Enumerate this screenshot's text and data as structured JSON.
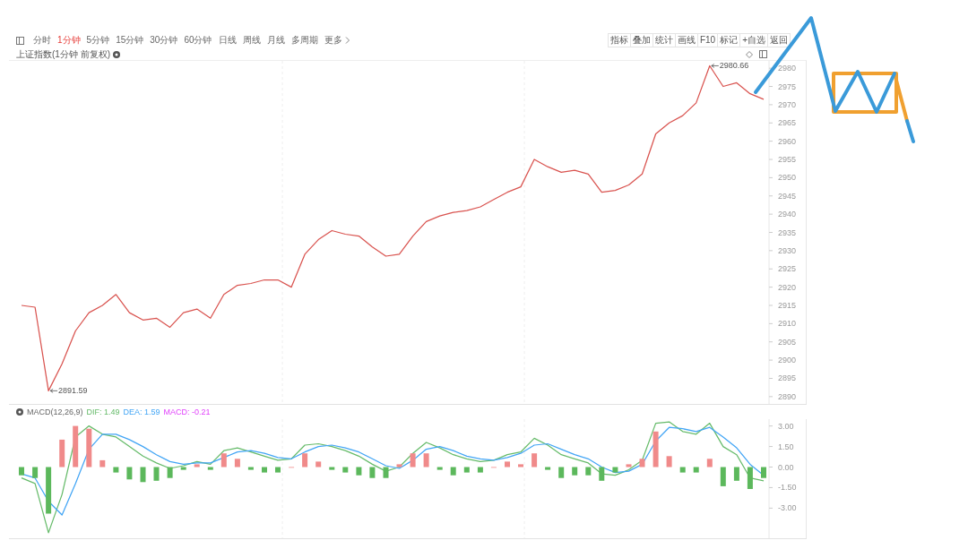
{
  "toolbar": {
    "periods": [
      {
        "label": "分时",
        "selected": false
      },
      {
        "label": "1分钟",
        "selected": true
      },
      {
        "label": "5分钟",
        "selected": false
      },
      {
        "label": "15分钟",
        "selected": false
      },
      {
        "label": "30分钟",
        "selected": false
      },
      {
        "label": "60分钟",
        "selected": false
      },
      {
        "label": "日线",
        "selected": false
      },
      {
        "label": "周线",
        "selected": false
      },
      {
        "label": "月线",
        "selected": false
      },
      {
        "label": "多周期",
        "selected": false
      }
    ],
    "more": "更多",
    "tools": [
      "指标",
      "叠加",
      "统计",
      "画线",
      "F10",
      "标记",
      "+自选",
      "返回"
    ]
  },
  "price_panel": {
    "chart_data": {
      "type": "line",
      "title": "上证指数(1分钟 前复权)",
      "categories": [
        null,
        null,
        null,
        null,
        null,
        null,
        null,
        null,
        null,
        null,
        null,
        null,
        null,
        null,
        null,
        null,
        null,
        null,
        null,
        null,
        null,
        null,
        null,
        null,
        null,
        null,
        null,
        null,
        null,
        null,
        null,
        null,
        null,
        null,
        null,
        null,
        null,
        null,
        null,
        null,
        null,
        null,
        null,
        null,
        null,
        null,
        null,
        null,
        null,
        null,
        null,
        null,
        null,
        null,
        null,
        null
      ],
      "series": [
        {
          "color": "#d9534f",
          "values": [
            2915,
            2914.5,
            2891.59,
            2899,
            2908,
            2913,
            2915,
            2918,
            2913,
            2911,
            2911.5,
            2909,
            2913,
            2914,
            2911.5,
            2918,
            2920.5,
            2921,
            2922,
            2922,
            2920,
            2929,
            2933,
            2935.5,
            2934.5,
            2934,
            2931,
            2928.5,
            2929,
            2934,
            2938,
            2939.5,
            2940.5,
            2941,
            2942,
            2944,
            2946,
            2947.5,
            2955,
            2953,
            2951.5,
            2952,
            2951,
            2946,
            2946.5,
            2948,
            2951,
            2962,
            2965,
            2967,
            2970.5,
            2980.66,
            2975,
            2976,
            2973,
            2971.5
          ]
        }
      ],
      "ylim": [
        2888,
        2982
      ],
      "yticks": [
        {
          "value": 2980,
          "label": "2980"
        },
        {
          "value": 2975,
          "label": "2975"
        },
        {
          "value": 2970,
          "label": "2970"
        },
        {
          "value": 2965,
          "label": "2965"
        },
        {
          "value": 2960,
          "label": "2960"
        },
        {
          "value": 2955,
          "label": "2955"
        },
        {
          "value": 2950,
          "label": "2950"
        },
        {
          "value": 2945,
          "label": "2945"
        },
        {
          "value": 2940,
          "label": "2940"
        },
        {
          "value": 2935,
          "label": "2935"
        },
        {
          "value": 2930,
          "label": "2930"
        },
        {
          "value": 2925,
          "label": "2925"
        },
        {
          "value": 2920,
          "label": "2920"
        },
        {
          "value": 2915,
          "label": "2915"
        },
        {
          "value": 2910,
          "label": "2910"
        },
        {
          "value": 2905,
          "label": "2905"
        },
        {
          "value": 2900,
          "label": "2900"
        },
        {
          "value": 2895,
          "label": "2895"
        },
        {
          "value": 2890,
          "label": "2890"
        }
      ],
      "annotations": [
        "2980.66",
        "2891.59"
      ]
    }
  },
  "macd_panel": {
    "chart_data": {
      "type": "bar",
      "title": "MACD(12,26,9)",
      "categories": [
        null,
        null,
        null,
        null,
        null,
        null,
        null,
        null,
        null,
        null,
        null,
        null,
        null,
        null,
        null,
        null,
        null,
        null,
        null,
        null,
        null,
        null,
        null,
        null,
        null,
        null,
        null,
        null,
        null,
        null,
        null,
        null,
        null,
        null,
        null,
        null,
        null,
        null,
        null,
        null,
        null,
        null,
        null,
        null,
        null,
        null,
        null,
        null,
        null,
        null,
        null,
        null,
        null,
        null,
        null,
        null
      ],
      "series": [
        {
          "name": "DIF: 1.49",
          "color": "#66bb6a",
          "type": "line",
          "values": [
            -0.8,
            -1.2,
            -4.8,
            -2.0,
            2.2,
            3.0,
            2.4,
            2.2,
            1.5,
            0.8,
            0.3,
            -0.1,
            0.1,
            0.4,
            0.2,
            1.2,
            1.4,
            1.1,
            0.8,
            0.5,
            0.6,
            1.6,
            1.7,
            1.5,
            1.2,
            0.8,
            0.2,
            -0.3,
            0.0,
            1.0,
            1.8,
            1.4,
            0.9,
            0.6,
            0.4,
            0.5,
            0.9,
            1.1,
            2.1,
            1.6,
            0.9,
            0.6,
            0.3,
            -0.5,
            -0.6,
            -0.2,
            0.5,
            3.2,
            3.3,
            2.6,
            2.4,
            3.2,
            1.5,
            0.9,
            -0.8,
            -1.0
          ]
        },
        {
          "name": "DEA: 1.59",
          "color": "#42a5f5",
          "type": "line",
          "values": [
            -0.5,
            -0.8,
            -2.5,
            -3.5,
            -1.2,
            1.3,
            2.4,
            2.4,
            2.0,
            1.5,
            0.9,
            0.4,
            0.2,
            0.3,
            0.3,
            0.7,
            1.1,
            1.2,
            1.0,
            0.7,
            0.6,
            1.1,
            1.5,
            1.6,
            1.4,
            1.1,
            0.6,
            0.1,
            -0.1,
            0.5,
            1.3,
            1.5,
            1.2,
            0.8,
            0.6,
            0.5,
            0.7,
            1.0,
            1.6,
            1.7,
            1.3,
            0.9,
            0.6,
            0.0,
            -0.4,
            -0.3,
            0.2,
            1.9,
            2.9,
            2.8,
            2.6,
            2.9,
            2.2,
            1.4,
            0.2,
            -0.6
          ]
        },
        {
          "name": "MACD: -0.21",
          "color": "#e040fb",
          "colors": [
            "#5cb85c",
            "#5cb85c",
            "#5cb85c",
            "#f08a8a",
            "#f08a8a",
            "#f08a8a",
            "#f08a8a",
            "#5cb85c",
            "#5cb85c",
            "#5cb85c",
            "#5cb85c",
            "#5cb85c",
            "#5cb85c",
            "#f08a8a",
            "#5cb85c",
            "#f08a8a",
            "#f08a8a",
            "#5cb85c",
            "#5cb85c",
            "#5cb85c",
            "#f08a8a",
            "#f08a8a",
            "#f08a8a",
            "#5cb85c",
            "#5cb85c",
            "#5cb85c",
            "#5cb85c",
            "#5cb85c",
            "#f08a8a",
            "#f08a8a",
            "#f08a8a",
            "#5cb85c",
            "#5cb85c",
            "#5cb85c",
            "#5cb85c",
            "#f08a8a",
            "#f08a8a",
            "#f08a8a",
            "#f08a8a",
            "#5cb85c",
            "#5cb85c",
            "#5cb85c",
            "#5cb85c",
            "#5cb85c",
            "#5cb85c",
            "#f08a8a",
            "#f08a8a",
            "#f08a8a",
            "#f08a8a",
            "#5cb85c",
            "#5cb85c",
            "#f08a8a",
            "#5cb85c",
            "#5cb85c",
            "#5cb85c",
            "#5cb85c"
          ],
          "values": [
            -0.6,
            -0.8,
            -3.4,
            2.0,
            3.0,
            2.8,
            0.5,
            -0.4,
            -0.9,
            -1.1,
            -1.0,
            -0.8,
            -0.2,
            0.2,
            -0.2,
            1.0,
            0.6,
            -0.2,
            -0.4,
            -0.4,
            0.0,
            1.0,
            0.4,
            -0.2,
            -0.4,
            -0.6,
            -0.8,
            -0.8,
            0.2,
            1.0,
            1.0,
            -0.2,
            -0.6,
            -0.4,
            -0.4,
            0.0,
            0.4,
            0.2,
            1.0,
            -0.2,
            -0.8,
            -0.6,
            -0.6,
            -1.0,
            -0.4,
            0.2,
            0.6,
            2.6,
            0.8,
            -0.4,
            -0.4,
            0.6,
            -1.4,
            -1.0,
            -1.6,
            -0.8
          ]
        }
      ],
      "ylim": [
        -5.2,
        3.5
      ],
      "yticks": [
        {
          "value": 3,
          "label": "3.00"
        },
        {
          "value": 1.5,
          "label": "1.50"
        },
        {
          "value": 0,
          "label": "0.00"
        },
        {
          "value": -1.5,
          "label": "-1.50"
        },
        {
          "value": -3,
          "label": "-3.00"
        }
      ]
    }
  }
}
